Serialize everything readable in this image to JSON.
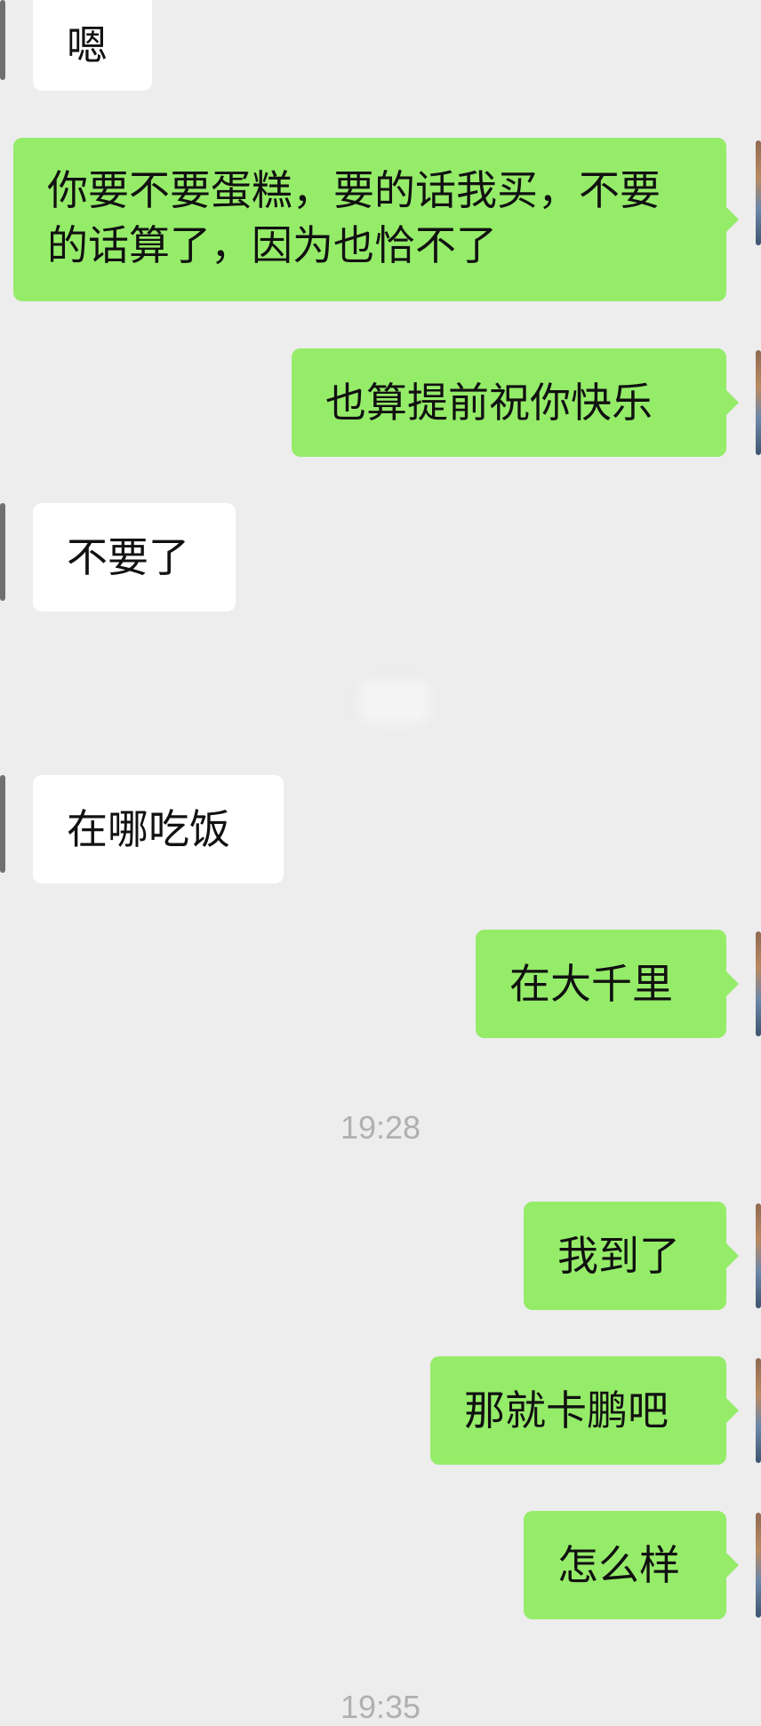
{
  "chat": {
    "messages": [
      {
        "side": "in",
        "text": "嗯"
      },
      {
        "side": "out",
        "text": "你要不要蛋糕，要的话我买，不要的话算了，因为也恰不了"
      },
      {
        "side": "out",
        "text": "也算提前祝你快乐"
      },
      {
        "side": "in",
        "text": "不要了"
      },
      {
        "side": "in",
        "text": "在哪吃饭"
      },
      {
        "side": "out",
        "text": "在大千里"
      },
      {
        "side": "out",
        "text": "我到了"
      },
      {
        "side": "out",
        "text": "那就卡鹏吧"
      },
      {
        "side": "out",
        "text": "怎么样"
      }
    ],
    "timestamps": [
      "19:28",
      "19:35"
    ]
  },
  "colors": {
    "background": "#ededed",
    "incoming_bubble": "#ffffff",
    "outgoing_bubble": "#95ec69",
    "timestamp_text": "#b0b0b0"
  }
}
